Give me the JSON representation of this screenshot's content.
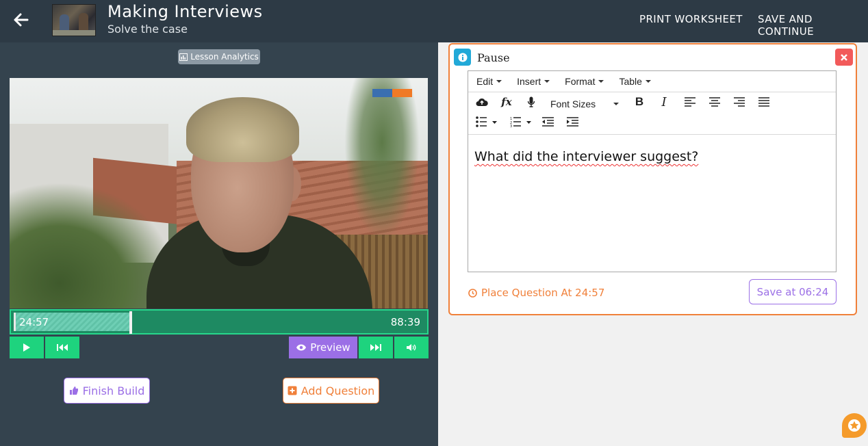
{
  "header": {
    "title": "Making Interviews",
    "subtitle": "Solve the case",
    "print_label": "PRINT WORKSHEET",
    "save_continue_label": "SAVE AND CONTINUE"
  },
  "left": {
    "analytics_label": "Lesson Analytics",
    "timeline": {
      "current": "24:57",
      "end": "88:39",
      "progress": 0.283
    },
    "preview_label": "Preview",
    "finish_label": "Finish Build",
    "add_question_label": "Add Question"
  },
  "card": {
    "title": "Pause",
    "menus": [
      "Edit",
      "Insert",
      "Format",
      "Table"
    ],
    "font_sizes_label": "Font Sizes",
    "content": "What did the interviewer suggest?",
    "place_label": "Place Question At 24:57",
    "save_label": "Save at 06:24"
  },
  "colors": {
    "header_bg": "#2d3a45",
    "left_bg": "#34434e",
    "green": "#1ed37e",
    "purple": "#9b6fe6",
    "orange": "#f0803a",
    "red": "#f25a5a",
    "info_blue": "#21a9d8"
  },
  "icons": [
    "back-arrow-icon",
    "chart-icon",
    "play-icon",
    "rewind-icon",
    "eye-icon",
    "fast-forward-icon",
    "volume-icon",
    "thumbs-up-icon",
    "plus-square-icon",
    "info-icon",
    "close-icon",
    "cloud-upload-icon",
    "formula-icon",
    "microphone-icon",
    "bold-icon",
    "italic-icon",
    "align-left-icon",
    "align-center-icon",
    "align-right-icon",
    "align-justify-icon",
    "bullet-list-icon",
    "numbered-list-icon",
    "outdent-icon",
    "indent-icon",
    "clock-icon",
    "star-icon"
  ]
}
